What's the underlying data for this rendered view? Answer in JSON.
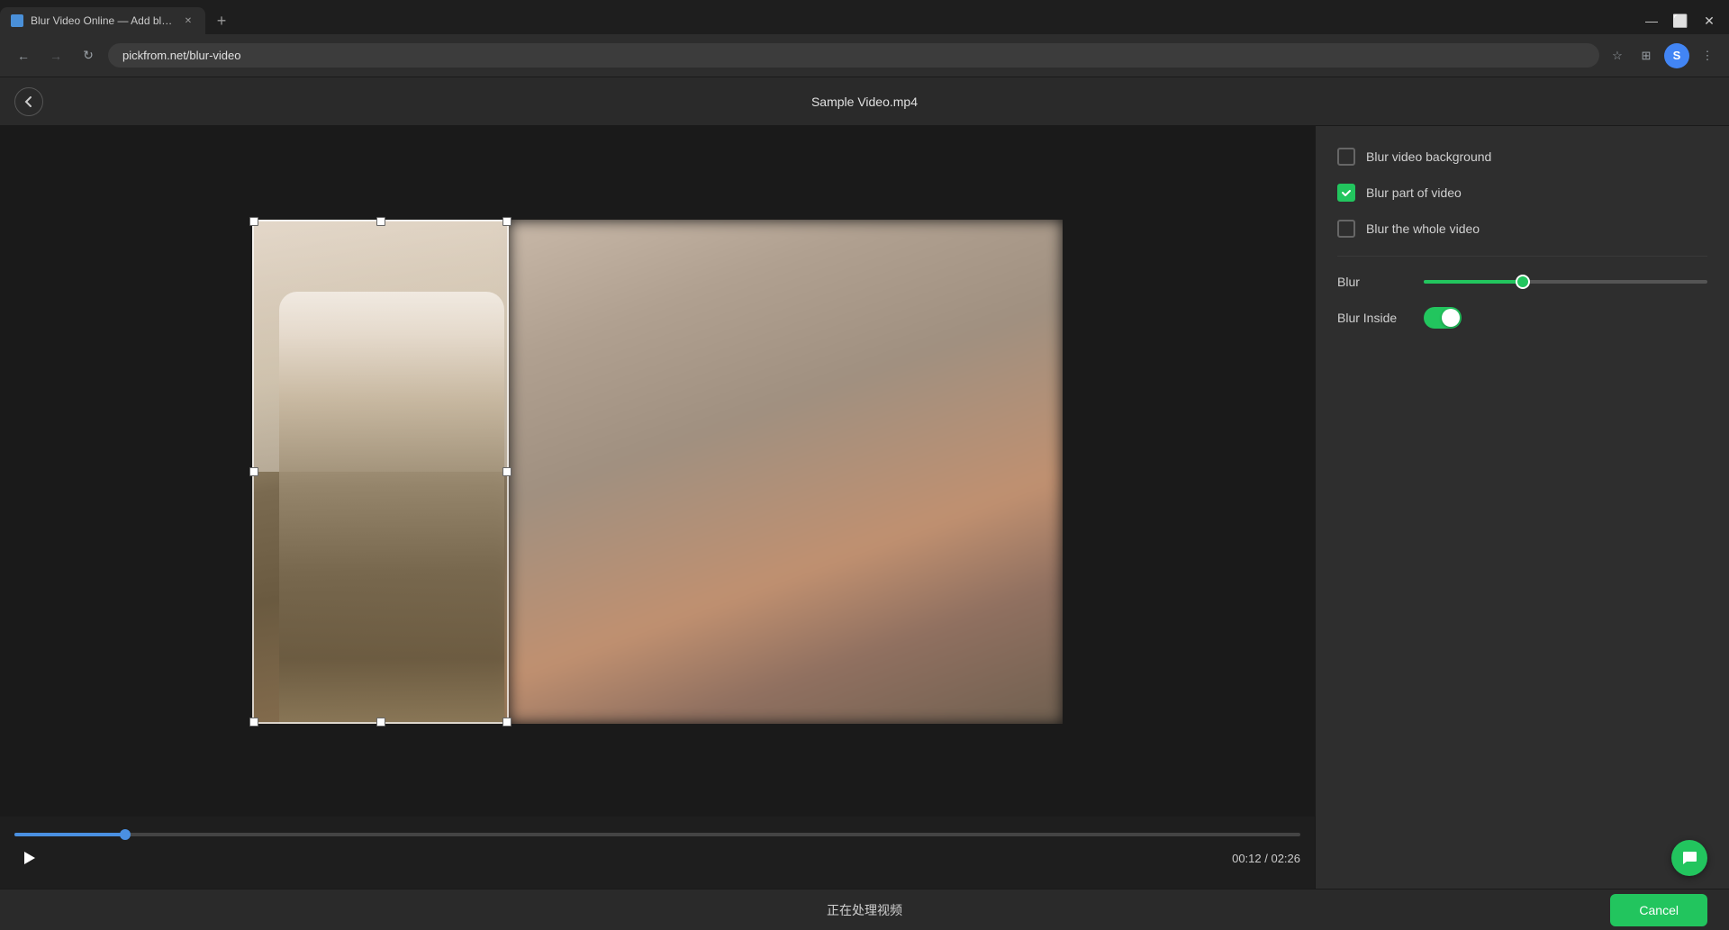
{
  "browser": {
    "tab_title": "Blur Video Online — Add blur e...",
    "url": "pickfrom.net/blur-video",
    "back_enabled": true,
    "forward_enabled": false,
    "reload_label": "↻",
    "new_tab_label": "+"
  },
  "app": {
    "title": "Sample Video.mp4",
    "back_label": "←"
  },
  "sidebar": {
    "option1": {
      "label": "Blur video background",
      "checked": false
    },
    "option2": {
      "label": "Blur part of video",
      "checked": true
    },
    "option3": {
      "label": "Blur the whole video",
      "checked": false
    },
    "blur_label": "Blur",
    "blur_inside_label": "Blur Inside"
  },
  "video": {
    "current_time": "00:12",
    "total_time": "02:26",
    "time_display": "00:12 / 02:26",
    "progress_percent": 8.6
  },
  "bottom_bar": {
    "status_text": "正在处理视频",
    "cancel_label": "Cancel"
  }
}
